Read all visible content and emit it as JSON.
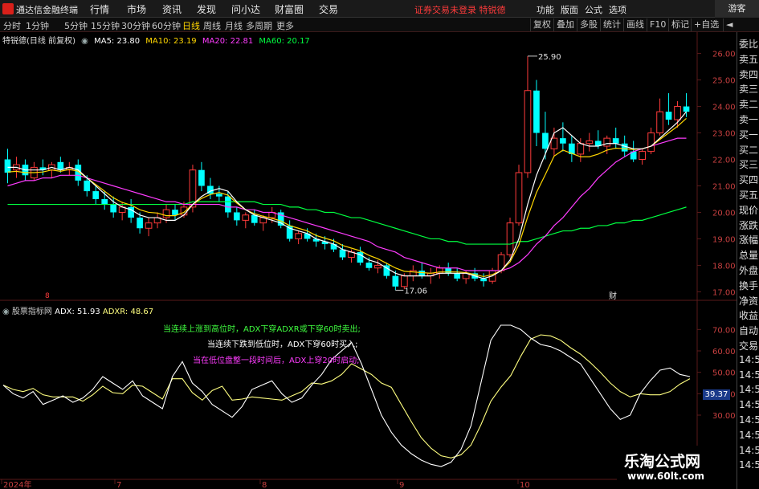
{
  "app": {
    "name": "通达信金融终端"
  },
  "menu": [
    "行情",
    "市场",
    "资讯",
    "发现",
    "问小达",
    "财富圈",
    "交易"
  ],
  "notice": "证券交易未登录  特锐德",
  "right_menu": [
    "功能",
    "版面",
    "公式",
    "选项"
  ],
  "guest_label": "游客",
  "periods": [
    "分时",
    "1分钟",
    "5分钟",
    "15分钟",
    "30分钟",
    "60分钟",
    "日线",
    "周线",
    "月线",
    "多周期",
    "更多"
  ],
  "active_period": "日线",
  "tools": [
    "复权",
    "叠加",
    "多股",
    "统计",
    "画线",
    "F10",
    "标记",
    "+自选",
    "◄"
  ],
  "stock_info": {
    "name": "特锐德(日线 前复权)",
    "ma5": "MA5: 23.80",
    "ma10": "MA10: 23.19",
    "ma20": "MA20: 22.81",
    "ma60": "MA60: 20.17"
  },
  "colors": {
    "up": "#ff3b3b",
    "down": "#00ffff",
    "ma5": "#ffffff",
    "ma10": "#ffd600",
    "ma20": "#ff3cff",
    "ma60": "#00ff40",
    "adx": "#ffffff",
    "adxr": "#ffff80"
  },
  "price_axis": [
    "26.00",
    "25.00",
    "24.00",
    "23.00",
    "22.00",
    "21.00",
    "20.00",
    "19.00",
    "18.00",
    "17.00"
  ],
  "annotations": {
    "high": "25.90",
    "low": "17.06",
    "date_marker": "8",
    "cai": "财"
  },
  "indicator": {
    "name": "股票指标网",
    "adx": "ADX: 51.93",
    "adxr": "ADXR: 48.67",
    "axis": [
      "70.00",
      "60.00",
      "50.00",
      "40.00",
      "30.00"
    ],
    "tag": "39.37",
    "notes": [
      "当连续上涨到高位时，ADX下穿ADXR或下穿60时卖出;",
      "当连续下跌到低位时，ADX下穿60时买入;",
      "当在低位盘整一段时间后，ADX上穿20时启动;"
    ]
  },
  "x_axis": [
    "2024年",
    "7",
    "8",
    "9",
    "10"
  ],
  "side_panel": [
    "委比",
    "卖五",
    "卖四",
    "卖三",
    "卖二",
    "卖一",
    "买一",
    "买二",
    "买三",
    "买四",
    "买五",
    "现价",
    "涨跌",
    "涨幅",
    "总量",
    "外盘",
    "换手",
    "净资",
    "收益",
    "自动",
    "交易",
    "14:5",
    "14:5",
    "14:5",
    "14:5",
    "14:5",
    "14:5",
    "14:5",
    "14:5"
  ],
  "watermark": {
    "title": "乐淘公式网",
    "url": "www.60lt.com"
  },
  "chart_data": {
    "type": "candlestick",
    "ylim": [
      16.8,
      26.2
    ],
    "candles": [
      [
        22.0,
        22.4,
        21.1,
        21.5
      ],
      [
        21.6,
        22.1,
        21.3,
        21.8
      ],
      [
        21.8,
        22.0,
        21.2,
        21.4
      ],
      [
        21.3,
        21.9,
        21.2,
        21.7
      ],
      [
        21.7,
        22.0,
        21.4,
        21.6
      ],
      [
        21.6,
        21.9,
        21.3,
        21.8
      ],
      [
        21.9,
        22.1,
        21.5,
        21.6
      ],
      [
        21.6,
        21.9,
        21.4,
        21.7
      ],
      [
        21.8,
        22.0,
        21.0,
        21.2
      ],
      [
        21.2,
        21.4,
        20.6,
        20.8
      ],
      [
        20.8,
        21.0,
        20.3,
        20.5
      ],
      [
        20.5,
        20.8,
        20.1,
        20.3
      ],
      [
        20.3,
        20.6,
        19.8,
        20.0
      ],
      [
        20.0,
        20.4,
        19.7,
        20.2
      ],
      [
        20.2,
        20.5,
        19.6,
        19.8
      ],
      [
        19.8,
        20.0,
        19.2,
        19.4
      ],
      [
        19.4,
        19.8,
        19.1,
        19.6
      ],
      [
        19.6,
        20.0,
        19.4,
        19.8
      ],
      [
        19.8,
        20.3,
        19.6,
        20.1
      ],
      [
        20.1,
        20.3,
        19.7,
        19.9
      ],
      [
        19.9,
        20.4,
        19.8,
        20.2
      ],
      [
        20.2,
        21.8,
        20.0,
        21.6
      ],
      [
        21.6,
        21.9,
        20.8,
        21.0
      ],
      [
        21.0,
        21.3,
        20.5,
        20.7
      ],
      [
        20.7,
        21.0,
        20.4,
        20.6
      ],
      [
        20.6,
        20.8,
        19.8,
        20.0
      ],
      [
        20.0,
        20.2,
        19.5,
        19.7
      ],
      [
        19.7,
        20.0,
        19.4,
        19.9
      ],
      [
        19.9,
        20.1,
        19.5,
        19.6
      ],
      [
        19.6,
        19.9,
        19.3,
        19.8
      ],
      [
        19.8,
        20.2,
        19.6,
        20.0
      ],
      [
        20.0,
        20.1,
        19.4,
        19.5
      ],
      [
        19.5,
        19.7,
        18.9,
        19.0
      ],
      [
        19.0,
        19.3,
        18.8,
        19.2
      ],
      [
        19.2,
        19.4,
        18.9,
        19.0
      ],
      [
        19.0,
        19.2,
        18.7,
        18.9
      ],
      [
        18.9,
        19.1,
        18.6,
        18.8
      ],
      [
        18.8,
        19.0,
        18.5,
        18.6
      ],
      [
        18.6,
        18.8,
        18.2,
        18.3
      ],
      [
        18.3,
        18.6,
        18.1,
        18.5
      ],
      [
        18.5,
        18.7,
        18.0,
        18.1
      ],
      [
        18.1,
        18.3,
        17.8,
        17.9
      ],
      [
        17.9,
        18.2,
        17.7,
        18.0
      ],
      [
        18.0,
        18.1,
        17.5,
        17.6
      ],
      [
        17.6,
        17.8,
        17.06,
        17.2
      ],
      [
        17.2,
        17.7,
        17.1,
        17.6
      ],
      [
        17.6,
        18.0,
        17.4,
        17.8
      ],
      [
        17.8,
        18.1,
        17.5,
        17.6
      ],
      [
        17.6,
        17.9,
        17.3,
        17.7
      ],
      [
        17.7,
        18.0,
        17.5,
        17.9
      ],
      [
        17.9,
        18.1,
        17.6,
        17.7
      ],
      [
        17.7,
        17.9,
        17.4,
        17.5
      ],
      [
        17.5,
        17.8,
        17.3,
        17.7
      ],
      [
        17.7,
        17.9,
        17.4,
        17.5
      ],
      [
        17.5,
        17.7,
        17.2,
        17.4
      ],
      [
        17.4,
        17.9,
        17.3,
        17.8
      ],
      [
        17.8,
        18.5,
        17.7,
        18.4
      ],
      [
        18.4,
        19.8,
        18.3,
        19.6
      ],
      [
        19.6,
        21.8,
        19.5,
        21.5
      ],
      [
        21.5,
        25.9,
        21.3,
        24.6
      ],
      [
        24.6,
        25.0,
        22.5,
        23.0
      ],
      [
        23.0,
        23.8,
        22.0,
        22.4
      ],
      [
        22.4,
        23.2,
        22.1,
        22.8
      ],
      [
        22.8,
        23.4,
        22.3,
        22.6
      ],
      [
        22.6,
        22.9,
        21.9,
        22.2
      ],
      [
        22.2,
        22.8,
        21.9,
        22.6
      ],
      [
        22.6,
        23.0,
        22.3,
        22.7
      ],
      [
        22.7,
        23.1,
        22.4,
        22.5
      ],
      [
        22.5,
        22.9,
        22.2,
        22.8
      ],
      [
        22.8,
        23.2,
        22.4,
        22.6
      ],
      [
        22.6,
        22.9,
        22.1,
        22.3
      ],
      [
        22.3,
        22.7,
        21.9,
        22.0
      ],
      [
        22.0,
        22.4,
        21.8,
        22.3
      ],
      [
        22.3,
        23.2,
        22.2,
        23.0
      ],
      [
        23.0,
        24.3,
        22.9,
        23.8
      ],
      [
        23.8,
        24.5,
        23.3,
        23.5
      ],
      [
        23.5,
        24.2,
        23.2,
        24.0
      ],
      [
        24.0,
        24.5,
        23.6,
        23.8
      ]
    ],
    "ma5": [
      21.7,
      21.7,
      21.6,
      21.6,
      21.6,
      21.7,
      21.6,
      21.7,
      21.6,
      21.3,
      21.0,
      20.7,
      20.4,
      20.2,
      20.1,
      19.9,
      19.8,
      19.8,
      19.7,
      19.7,
      19.9,
      20.3,
      20.6,
      20.8,
      20.9,
      20.8,
      20.4,
      20.1,
      19.9,
      19.8,
      19.7,
      19.6,
      19.4,
      19.3,
      19.2,
      19.0,
      18.9,
      18.8,
      18.6,
      18.5,
      18.4,
      18.2,
      18.1,
      17.9,
      17.7,
      17.6,
      17.6,
      17.6,
      17.6,
      17.7,
      17.7,
      17.7,
      17.7,
      17.6,
      17.5,
      17.6,
      17.8,
      18.2,
      19.0,
      20.3,
      21.4,
      22.2,
      23.0,
      23.2,
      22.9,
      22.6,
      22.5,
      22.5,
      22.6,
      22.6,
      22.5,
      22.4,
      22.4,
      22.5,
      22.8,
      23.1,
      23.4,
      23.8
    ],
    "ma20": [
      21.0,
      21.1,
      21.2,
      21.2,
      21.3,
      21.3,
      21.4,
      21.4,
      21.4,
      21.3,
      21.2,
      21.1,
      21.0,
      20.9,
      20.8,
      20.7,
      20.6,
      20.5,
      20.4,
      20.4,
      20.3,
      20.3,
      20.3,
      20.3,
      20.3,
      20.2,
      20.2,
      20.1,
      20.1,
      20.0,
      20.0,
      19.9,
      19.8,
      19.7,
      19.6,
      19.5,
      19.4,
      19.3,
      19.2,
      19.1,
      19.0,
      18.9,
      18.7,
      18.6,
      18.5,
      18.3,
      18.2,
      18.1,
      18.0,
      17.9,
      17.9,
      17.9,
      17.8,
      17.8,
      17.8,
      17.8,
      17.8,
      17.9,
      18.1,
      18.4,
      18.8,
      19.1,
      19.5,
      19.8,
      20.2,
      20.6,
      20.9,
      21.3,
      21.6,
      21.9,
      22.1,
      22.3,
      22.4,
      22.5,
      22.6,
      22.7,
      22.8,
      22.8
    ],
    "ma60": [
      20.3,
      20.3,
      20.3,
      20.3,
      20.3,
      20.3,
      20.3,
      20.3,
      20.3,
      20.3,
      20.3,
      20.3,
      20.3,
      20.3,
      20.3,
      20.3,
      20.3,
      20.3,
      20.3,
      20.3,
      20.3,
      20.4,
      20.4,
      20.4,
      20.4,
      20.4,
      20.4,
      20.4,
      20.4,
      20.3,
      20.3,
      20.3,
      20.2,
      20.2,
      20.1,
      20.1,
      20.0,
      20.0,
      19.9,
      19.8,
      19.8,
      19.7,
      19.6,
      19.5,
      19.4,
      19.3,
      19.2,
      19.1,
      19.0,
      19.0,
      18.9,
      18.9,
      18.8,
      18.8,
      18.8,
      18.8,
      18.8,
      18.8,
      18.9,
      18.9,
      19.0,
      19.1,
      19.2,
      19.3,
      19.3,
      19.4,
      19.4,
      19.5,
      19.5,
      19.6,
      19.6,
      19.7,
      19.7,
      19.8,
      19.9,
      20.0,
      20.1,
      20.2
    ],
    "adx": [
      44,
      40,
      38,
      41,
      35,
      37,
      39,
      36,
      38,
      42,
      48,
      45,
      42,
      46,
      39,
      36,
      33,
      48,
      55,
      45,
      41,
      35,
      32,
      29,
      34,
      42,
      44,
      46,
      40,
      36,
      38,
      44,
      49,
      56,
      60,
      64,
      54,
      42,
      30,
      22,
      16,
      12,
      9,
      7,
      6,
      8,
      14,
      25,
      45,
      65,
      72,
      72,
      70,
      66,
      63,
      62,
      60,
      57,
      54,
      47,
      40,
      33,
      28,
      30,
      40,
      46,
      51,
      52,
      49,
      48
    ]
  }
}
